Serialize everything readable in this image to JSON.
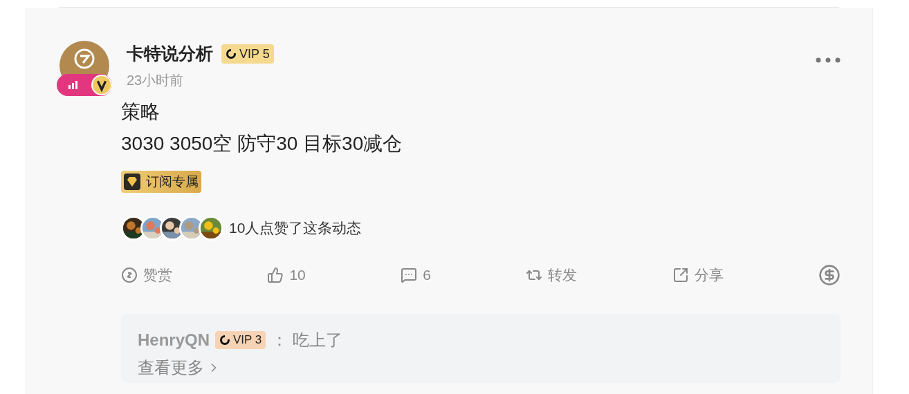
{
  "post": {
    "author": "卡特说分析",
    "vip": {
      "label": "VIP 5",
      "color": "#f5d98f"
    },
    "time": "23小时前",
    "lines": [
      "策略",
      "3030 3050空 防守30 目标30减仓"
    ],
    "tag": "订阅专属",
    "likes": {
      "text": "10人点赞了这条动态"
    },
    "actions": [
      {
        "kind": "tip",
        "label": "赞赏"
      },
      {
        "kind": "like",
        "label": "10"
      },
      {
        "kind": "comment",
        "label": "6"
      },
      {
        "kind": "repost",
        "label": "转发"
      },
      {
        "kind": "share",
        "label": "分享"
      },
      {
        "kind": "dollar"
      }
    ],
    "comments": [
      {
        "user": "HenryQN",
        "vip": {
          "label": "VIP 3",
          "color": "#f6d3b4"
        },
        "sep": "：",
        "text": "吃上了"
      }
    ],
    "more": "查看更多"
  }
}
